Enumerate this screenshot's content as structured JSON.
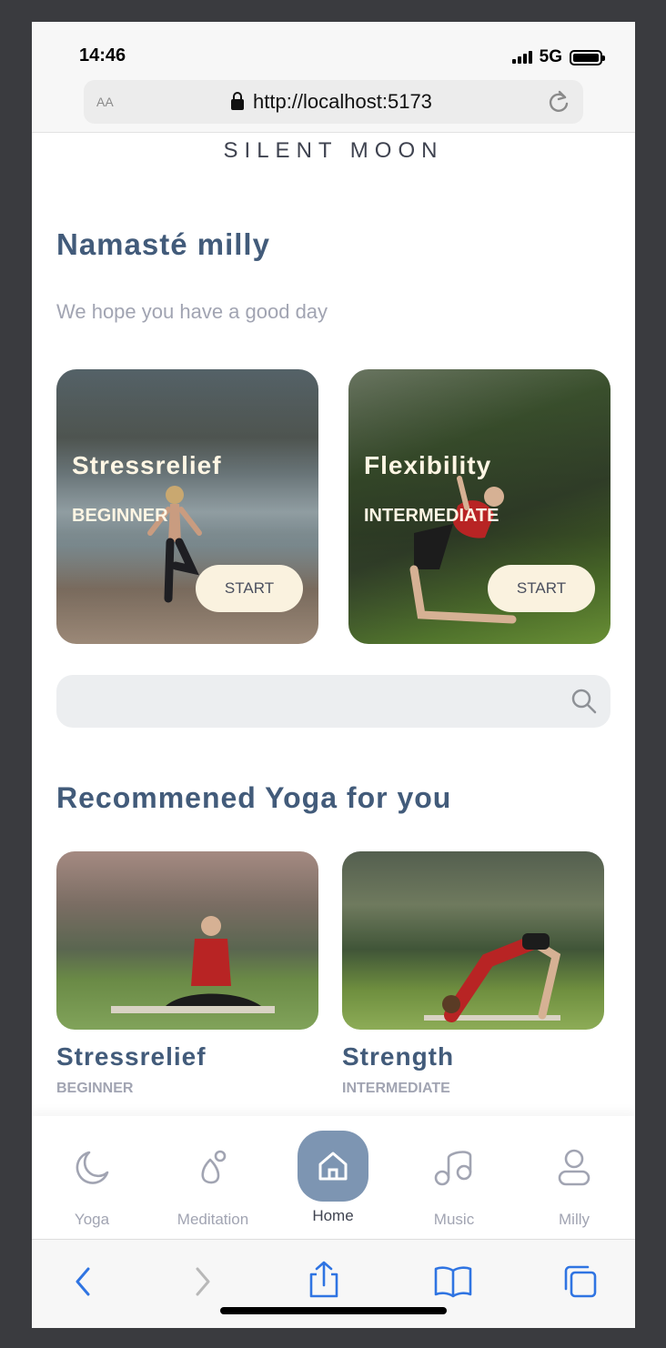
{
  "status": {
    "time": "14:46",
    "network": "5G"
  },
  "browser": {
    "aa_label": "AA",
    "url": "http://localhost:5173"
  },
  "brand": "SILENT  MOON",
  "greeting": "Namasté milly",
  "subtitle": "We hope you have a good day",
  "featured": [
    {
      "title": "Stressrelief",
      "level": "BEGINNER",
      "button": "START"
    },
    {
      "title": "Flexibility",
      "level": "INTERMEDIATE",
      "button": "START"
    }
  ],
  "search": {
    "placeholder": ""
  },
  "recommended": {
    "title": "Recommened Yoga for you",
    "items": [
      {
        "title": "Stressrelief",
        "level": "BEGINNER"
      },
      {
        "title": "Strength",
        "level": "INTERMEDIATE"
      }
    ]
  },
  "nav": {
    "items": [
      {
        "label": "Yoga",
        "icon": "moon-icon"
      },
      {
        "label": "Meditation",
        "icon": "meditation-icon"
      },
      {
        "label": "Home",
        "icon": "home-icon",
        "active": true
      },
      {
        "label": "Music",
        "icon": "music-icon"
      },
      {
        "label": "Milly",
        "icon": "user-icon"
      }
    ]
  },
  "colors": {
    "accent": "#425b7a",
    "nav_active": "#7d95b2",
    "button_bg": "#faf2df",
    "muted": "#a1a4b2"
  }
}
